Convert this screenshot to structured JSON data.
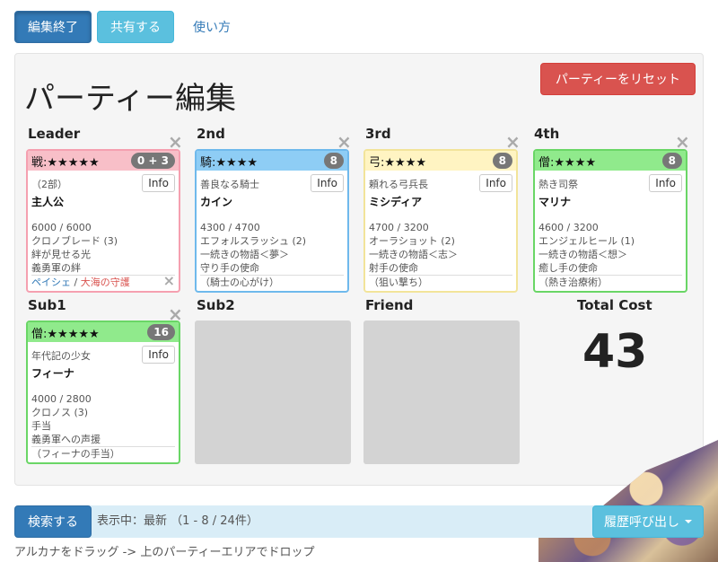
{
  "toolbar": {
    "finish_edit": "編集終了",
    "share": "共有する",
    "how_to": "使い方"
  },
  "party": {
    "title": "パーティー編集",
    "reset": "パーティーをリセット",
    "slots": {
      "leader": "Leader",
      "second": "2nd",
      "third": "3rd",
      "fourth": "4th",
      "sub1": "Sub1",
      "sub2": "Sub2",
      "friend": "Friend"
    },
    "cards": {
      "leader": {
        "head": "戦:★★★★★",
        "badge": "0 + 3",
        "info": "Info",
        "subtitle": "（2部）",
        "name": "主人公",
        "stats": [
          "6000 / 6000",
          "クロノブレード (3)",
          "絆が見せる光",
          "義勇軍の絆"
        ],
        "foot_blue": "ペイシェ",
        "foot_sep": " / ",
        "foot_red": "大海の守護"
      },
      "second": {
        "head": "騎:★★★★",
        "badge": "8",
        "info": "Info",
        "subtitle": "善良なる騎士",
        "name": "カイン",
        "stats": [
          "4300 / 4700",
          "エフォルスラッシュ (2)",
          "一続きの物語＜夢＞",
          "守り手の使命"
        ],
        "foot": "（騎士の心がけ）"
      },
      "third": {
        "head": "弓:★★★★",
        "badge": "8",
        "info": "Info",
        "subtitle": "頼れる弓兵長",
        "name": "ミシディア",
        "stats": [
          "4700 / 3200",
          "オーラショット (2)",
          "一続きの物語＜志＞",
          "射手の使命"
        ],
        "foot": "（狙い撃ち）"
      },
      "fourth": {
        "head": "僧:★★★★",
        "badge": "8",
        "info": "Info",
        "subtitle": "熱き司祭",
        "name": "マリナ",
        "stats": [
          "4600 / 3200",
          "エンジェルヒール (1)",
          "一続きの物語＜想＞",
          "癒し手の使命"
        ],
        "foot": "（熱き治療術）"
      },
      "sub1": {
        "head": "僧:★★★★★",
        "badge": "16",
        "info": "Info",
        "subtitle": "年代記の少女",
        "name": "フィーナ",
        "stats": [
          "4000 / 2800",
          "クロノス (3)",
          "手当",
          "義勇軍への声援"
        ],
        "foot": "（フィーナの手当）"
      }
    },
    "total_cost_label": "Total Cost",
    "total_cost": "43"
  },
  "search": {
    "button": "検索する",
    "status": "表示中：最新 （1 - 8 / 24件）",
    "history": "履歴呼び出し"
  },
  "hint": "アルカナをドラッグ -> 上のパーティーエリアでドロップ",
  "colors": {
    "warrior": "#f8bfc8",
    "knight": "#8ecdf5",
    "archer": "#fff4c2",
    "priest": "#90ea8c"
  }
}
